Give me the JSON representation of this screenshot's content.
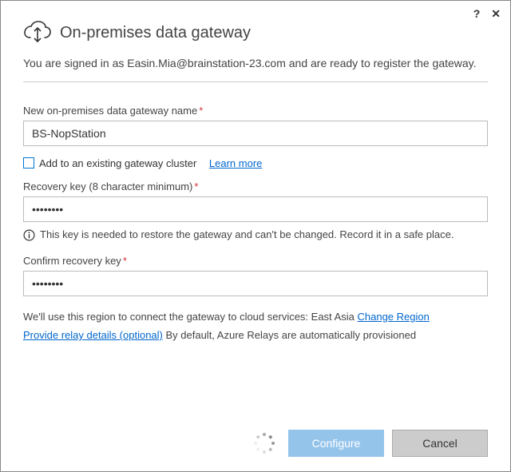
{
  "window": {
    "title": "On-premises data gateway",
    "subheader": "You are signed in as Easin.Mia@brainstation-23.com and are ready to register the gateway."
  },
  "form": {
    "gateway_name": {
      "label": "New on-premises data gateway name",
      "value": "BS-NopStation"
    },
    "add_to_cluster": {
      "label": "Add to an existing gateway cluster",
      "learn_more": "Learn more"
    },
    "recovery_key": {
      "label": "Recovery key (8 character minimum)",
      "value": "••••••••",
      "info": "This key is needed to restore the gateway and can't be changed. Record it in a safe place."
    },
    "confirm_recovery_key": {
      "label": "Confirm recovery key",
      "value": "••••••••"
    },
    "region": {
      "prefix": "We'll use this region to connect the gateway to cloud services: ",
      "value": "East Asia",
      "change_link": "Change Region"
    },
    "relay": {
      "link": "Provide relay details (optional)",
      "suffix": " By default, Azure Relays are automatically provisioned"
    }
  },
  "buttons": {
    "configure": "Configure",
    "cancel": "Cancel"
  },
  "icons": {
    "cloud": "cloud-upload-icon",
    "help": "?",
    "close": "✕",
    "info": "ⓘ"
  }
}
